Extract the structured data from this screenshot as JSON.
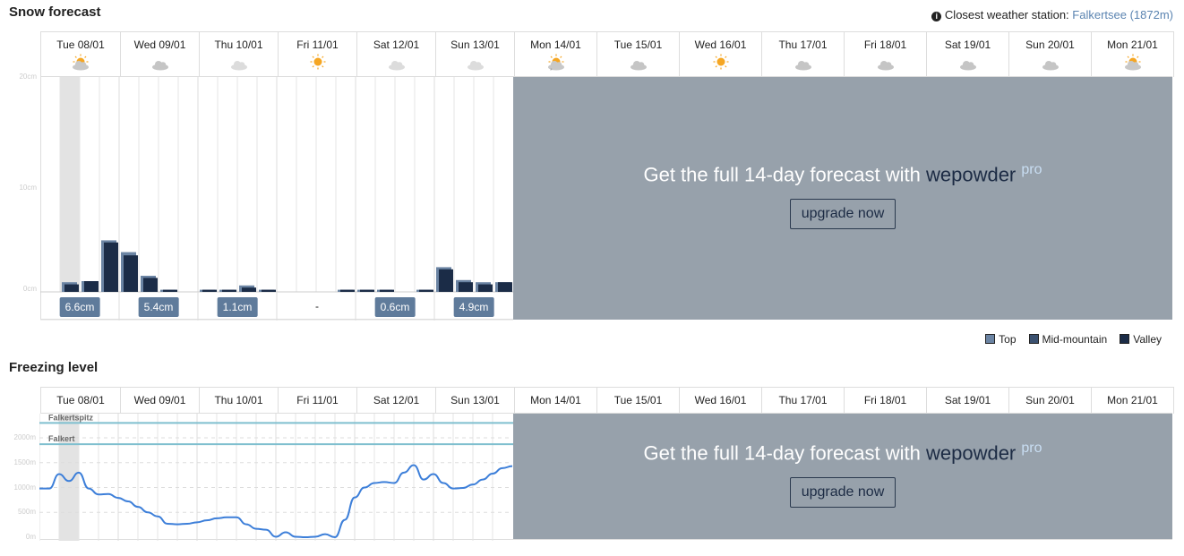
{
  "snow": {
    "title": "Snow forecast",
    "station": {
      "label": "Closest weather station:",
      "value": "Falkertsee (1872m)"
    },
    "days": [
      {
        "label": "Tue 08/01",
        "icon": "partly-cloudy-icon"
      },
      {
        "label": "Wed 09/01",
        "icon": "cloud-icon"
      },
      {
        "label": "Thu 10/01",
        "icon": "light-cloud-icon"
      },
      {
        "label": "Fri 11/01",
        "icon": "sun-icon"
      },
      {
        "label": "Sat 12/01",
        "icon": "light-cloud-icon"
      },
      {
        "label": "Sun 13/01",
        "icon": "light-cloud-icon"
      },
      {
        "label": "Mon 14/01",
        "icon": "partly-cloudy-snow-icon"
      },
      {
        "label": "Tue 15/01",
        "icon": "cloud-icon"
      },
      {
        "label": "Wed 16/01",
        "icon": "sun-icon"
      },
      {
        "label": "Thu 17/01",
        "icon": "cloud-icon"
      },
      {
        "label": "Fri 18/01",
        "icon": "cloud-icon"
      },
      {
        "label": "Sat 19/01",
        "icon": "cloud-icon"
      },
      {
        "label": "Sun 20/01",
        "icon": "cloud-icon"
      },
      {
        "label": "Mon 21/01",
        "icon": "partly-cloudy-icon"
      }
    ],
    "totals": [
      "6.6cm",
      "5.4cm",
      "1.1cm",
      "-",
      "0.6cm",
      "4.9cm"
    ],
    "yticks": [
      "20cm",
      "10cm",
      "0cm"
    ],
    "overlay": {
      "text": "Get the full 14-day forecast with",
      "brand": "wepowder",
      "pro": "pro",
      "button": "upgrade now"
    },
    "legend": [
      {
        "label": "Top",
        "color": "#6b84a3"
      },
      {
        "label": "Mid-mountain",
        "color": "#3b5170"
      },
      {
        "label": "Valley",
        "color": "#1b2c47"
      }
    ]
  },
  "chart_data": [
    {
      "type": "bar",
      "ylim": [
        0,
        20
      ],
      "unit": "cm",
      "categories_per_day": 4,
      "series": [
        {
          "name": "Top",
          "color": "#6b84a3",
          "values": [
            0,
            0.9,
            1.0,
            4.8,
            3.7,
            1.5,
            0.2,
            0,
            0.2,
            0.2,
            0.6,
            0.2,
            0,
            0,
            0,
            0.2,
            0.2,
            0.2,
            0,
            0.2,
            2.3,
            1.1,
            0.9,
            0.9
          ]
        },
        {
          "name": "Valley",
          "color": "#1b2c47",
          "values": [
            0,
            0.7,
            1.0,
            4.6,
            3.4,
            1.3,
            0.2,
            0,
            0.2,
            0.2,
            0.4,
            0.2,
            0,
            0,
            0,
            0.2,
            0.2,
            0.2,
            0,
            0.2,
            2.1,
            0.9,
            0.7,
            0.9
          ]
        }
      ],
      "highlight_slot": 1
    },
    {
      "type": "line",
      "title": "Freezing level",
      "ylim": [
        0,
        2500
      ],
      "yticks": [
        "2000m",
        "1500m",
        "1000m",
        "500m",
        "0m"
      ],
      "color": "#3d7fd9",
      "reference_lines": [
        {
          "label": "Falkertspitz",
          "value": 2300,
          "color": "#7fbfcf"
        },
        {
          "label": "Falkert",
          "value": 1872,
          "color": "#7fbfcf"
        }
      ],
      "values": [
        980,
        980,
        1270,
        1130,
        1300,
        980,
        860,
        870,
        790,
        720,
        610,
        500,
        420,
        270,
        260,
        270,
        300,
        340,
        380,
        400,
        400,
        260,
        170,
        150,
        10,
        100,
        10,
        0,
        10,
        60,
        0,
        350,
        800,
        1000,
        1090,
        1110,
        1090,
        1300,
        1450,
        1160,
        1270,
        1090,
        980,
        990,
        1060,
        1160,
        1280,
        1390,
        1430
      ]
    }
  ],
  "freezing": {
    "title": "Freezing level"
  }
}
